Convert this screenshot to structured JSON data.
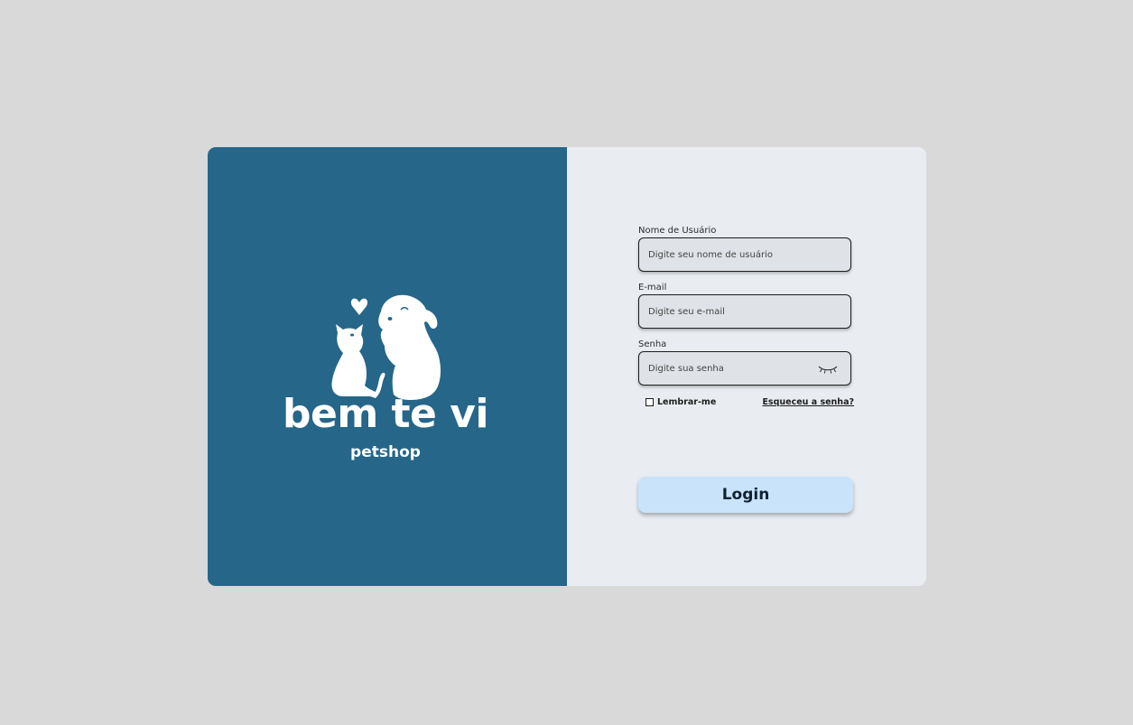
{
  "brand": {
    "name": "bem te vi",
    "tagline": "petshop",
    "logo_icon": "cat-and-dog-heart-logo"
  },
  "form": {
    "username": {
      "label": "Nome de Usuário",
      "placeholder": "Digite seu nome de usuário",
      "value": ""
    },
    "email": {
      "label": "E-mail",
      "placeholder": "Digite seu e-mail",
      "value": ""
    },
    "password": {
      "label": "Senha",
      "placeholder": "Digite sua senha",
      "value": "",
      "toggle_icon": "eye-closed-icon"
    },
    "remember_me": {
      "label": "Lembrar-me",
      "checked": false
    },
    "forgot_password": "Esqueceu a senha?",
    "submit_label": "Login"
  },
  "colors": {
    "page_background": "#d9d9d9",
    "brand_panel": "#256689",
    "form_panel": "#e9edf2",
    "input_background": "#dfe2e6",
    "login_button": "#c9e3fb",
    "login_text": "#0f2232"
  }
}
